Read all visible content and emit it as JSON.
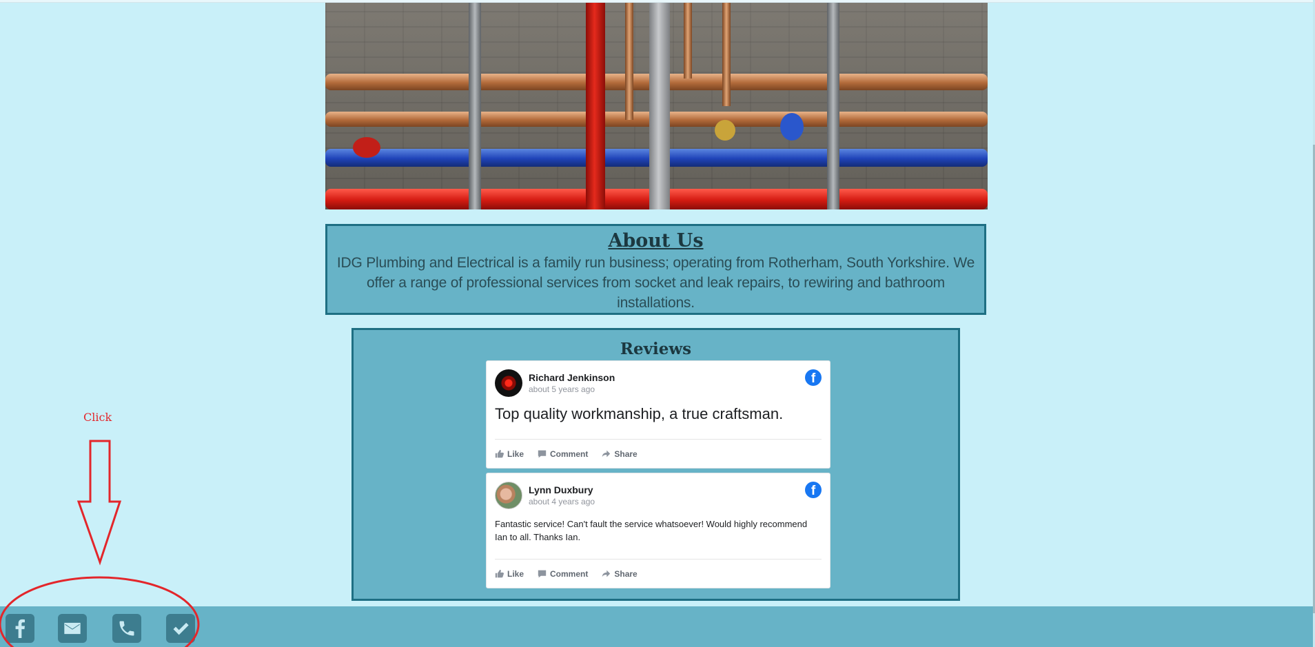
{
  "hero": {
    "image_alt": "Plumbing pipes on a brick wall"
  },
  "about": {
    "title": "About Us",
    "text": "IDG Plumbing and Electrical is a family run business; operating from Rotherham, South Yorkshire. We offer a range of professional services from socket and leak repairs, to rewiring and bathroom installations."
  },
  "reviews": {
    "title": "Reviews",
    "items": [
      {
        "name": "Richard Jenkinson",
        "time": "about 5 years ago",
        "text": "Top quality workmanship, a true craftsman."
      },
      {
        "name": "Lynn Duxbury",
        "time": "about 4 years ago",
        "text": "Fantastic service! Can't fault the service whatsoever! Would highly recommend Ian to all. Thanks Ian."
      }
    ],
    "actions": {
      "like": "Like",
      "comment": "Comment",
      "share": "Share"
    }
  },
  "footer": {
    "icons": [
      "facebook-icon",
      "email-icon",
      "phone-icon",
      "check-icon"
    ]
  },
  "annotation": {
    "label": "Click",
    "color": "#e3262b"
  },
  "colors": {
    "page_bg": "#c9f0f9",
    "panel": "#67b3c7",
    "panel_border": "#1e6f83",
    "footer_icon": "#3d7d8f",
    "facebook": "#1877f2"
  }
}
